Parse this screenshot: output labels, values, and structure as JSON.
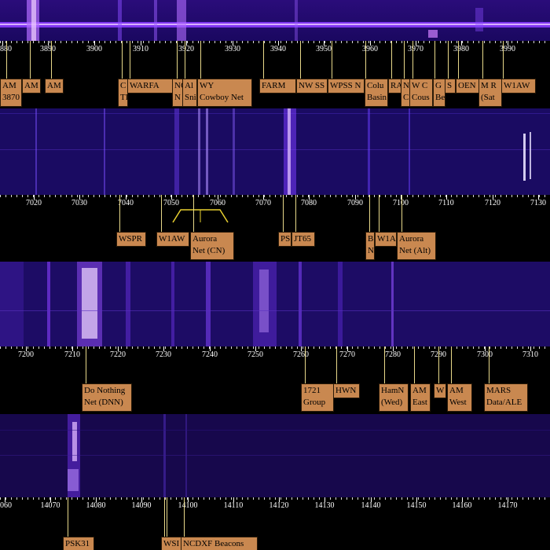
{
  "colors": {
    "label_bg": "#c98850",
    "label_border": "#2a1a08",
    "flag_line": "#e8d98a",
    "waterfall_bg": "#14084a",
    "signal_bright": "#f0d0ff",
    "signal_purple": "#8a2cff"
  },
  "panels": [
    {
      "id": "band-80m",
      "ticks": [
        "880",
        "3890",
        "3900",
        "3910",
        "3920",
        "3930",
        "3940",
        "3950",
        "3960",
        "3970",
        "3980",
        "3990"
      ],
      "labels": [
        {
          "text": "AM 3870",
          "lines": [
            "AM",
            "3870"
          ]
        },
        {
          "text": "AM",
          "lines": [
            "AM"
          ]
        },
        {
          "text": "AM",
          "lines": [
            "AM"
          ]
        },
        {
          "text": "C TI",
          "lines": [
            "C",
            "TI"
          ]
        },
        {
          "text": "WARFA",
          "lines": [
            "WARFA"
          ]
        },
        {
          "text": "NQ N",
          "lines": [
            "NQ",
            "N"
          ]
        },
        {
          "text": "Al Sni",
          "lines": [
            "Al",
            "Sni"
          ]
        },
        {
          "text": "WY Cowboy Net",
          "lines": [
            "WY",
            "Cowboy Net"
          ]
        },
        {
          "text": "FARM",
          "lines": [
            "FARM"
          ]
        },
        {
          "text": "NW SS",
          "lines": [
            "NW SS"
          ]
        },
        {
          "text": "WPSS N",
          "lines": [
            "WPSS N"
          ]
        },
        {
          "text": "Colu Basin",
          "lines": [
            "Colu",
            "Basin"
          ]
        },
        {
          "text": "RA",
          "lines": [
            "RA"
          ]
        },
        {
          "text": "N C",
          "lines": [
            "N",
            "C"
          ]
        },
        {
          "text": "W C Cous",
          "lines": [
            "W C",
            "Cous"
          ]
        },
        {
          "text": "G Be",
          "lines": [
            "G",
            "Be"
          ]
        },
        {
          "text": "S",
          "lines": [
            "S"
          ]
        },
        {
          "text": "OEN",
          "lines": [
            "OEN"
          ]
        },
        {
          "text": "M R (Sat",
          "lines": [
            "M R",
            "(Sat"
          ]
        },
        {
          "text": "W1AW",
          "lines": [
            "W1AW"
          ]
        }
      ]
    },
    {
      "id": "band-40m-low",
      "ticks": [
        "7020",
        "7030",
        "7040",
        "7050",
        "7060",
        "7070",
        "7080",
        "7090",
        "7100",
        "7110",
        "7120",
        "7130"
      ],
      "labels": [
        {
          "text": "WSPR",
          "lines": [
            "WSPR"
          ]
        },
        {
          "text": "W1AW",
          "lines": [
            "W1AW"
          ]
        },
        {
          "text": "Aurora Net (CN)",
          "lines": [
            "Aurora",
            "Net (CN)"
          ]
        },
        {
          "text": "PS",
          "lines": [
            "PS"
          ]
        },
        {
          "text": "JT65",
          "lines": [
            "JT65"
          ]
        },
        {
          "text": "B N",
          "lines": [
            "B",
            "N"
          ]
        },
        {
          "text": "W1A",
          "lines": [
            "W1A"
          ]
        },
        {
          "text": "Aurora Net (Alt)",
          "lines": [
            "Aurora",
            "Net (Alt)"
          ]
        }
      ]
    },
    {
      "id": "band-40m-high",
      "ticks": [
        "7200",
        "7210",
        "7220",
        "7230",
        "7240",
        "7250",
        "7260",
        "7270",
        "7280",
        "7290",
        "7300",
        "7310"
      ],
      "labels": [
        {
          "text": "Do Nothing Net (DNN)",
          "lines": [
            "Do Nothing",
            "Net (DNN)"
          ]
        },
        {
          "text": "1721 Group",
          "lines": [
            "1721",
            "Group"
          ]
        },
        {
          "text": "HWN",
          "lines": [
            "HWN"
          ]
        },
        {
          "text": "HamN (Wed)",
          "lines": [
            "HamN",
            "(Wed)"
          ]
        },
        {
          "text": "AM East",
          "lines": [
            "AM",
            "East"
          ]
        },
        {
          "text": "W",
          "lines": [
            "W"
          ]
        },
        {
          "text": "AM West",
          "lines": [
            "AM",
            "West"
          ]
        },
        {
          "text": "MARS Data/ALE",
          "lines": [
            "MARS",
            "Data/ALE"
          ]
        }
      ]
    },
    {
      "id": "band-20m",
      "ticks": [
        "060",
        "14070",
        "14080",
        "14090",
        "14100",
        "14110",
        "14120",
        "14130",
        "14140",
        "14150",
        "14160",
        "14170"
      ],
      "labels": [
        {
          "text": "PSK31",
          "lines": [
            "PSK31"
          ]
        },
        {
          "text": "WSI",
          "lines": [
            "WSI"
          ]
        },
        {
          "text": "NCDXF Beacons",
          "lines": [
            "NCDXF Beacons"
          ]
        }
      ]
    }
  ]
}
